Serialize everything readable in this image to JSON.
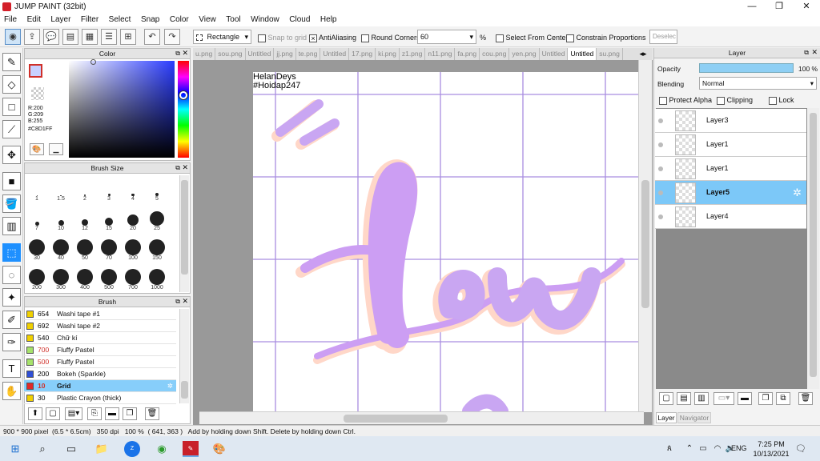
{
  "window": {
    "title": "JUMP PAINT (32bit)",
    "minimize": "—",
    "maximize": "❐",
    "close": "✕"
  },
  "menu": [
    "File",
    "Edit",
    "Layer",
    "Filter",
    "Select",
    "Snap",
    "Color",
    "View",
    "Tool",
    "Window",
    "Cloud",
    "Help"
  ],
  "toolbar": {
    "shape_select": "Rectangle",
    "snap_to_grid": "Snap to grid",
    "antialiasing": "AntiAliasing",
    "round_corners": "Round Corners",
    "round_value": "60",
    "percent": "%",
    "select_from_center": "Select From Center",
    "constrain_proportions": "Constrain Proportions",
    "deselect": "Deselec"
  },
  "color_panel": {
    "title": "Color",
    "r": "R:200",
    "g": "G:209",
    "b": "B:255",
    "hex": "#C8D1FF",
    "current_color": "#c8d1ff"
  },
  "brush_size_panel": {
    "title": "Brush Size",
    "sizes": [
      "1",
      "1.5",
      "2",
      "3",
      "4",
      "5",
      "7",
      "10",
      "12",
      "15",
      "20",
      "25",
      "30",
      "40",
      "50",
      "70",
      "100",
      "150",
      "200",
      "300",
      "400",
      "500",
      "700",
      "1000"
    ]
  },
  "brush_panel": {
    "title": "Brush",
    "items": [
      {
        "num": "654",
        "name": "Washi tape #1",
        "color": "#f0d000",
        "numColor": "#000"
      },
      {
        "num": "692",
        "name": "Washi tape #2",
        "color": "#f0d000",
        "numColor": "#000"
      },
      {
        "num": "540",
        "name": "Chữ kí",
        "color": "#f0d000",
        "numColor": "#000"
      },
      {
        "num": "700",
        "name": "Fluffy Pastel",
        "color": "#a6e26b",
        "numColor": "#d0302a"
      },
      {
        "num": "500",
        "name": "Fluffy Pastel",
        "color": "#a6e26b",
        "numColor": "#d0302a"
      },
      {
        "num": "200",
        "name": "Bokeh (Sparkle)",
        "color": "#2f4fd6",
        "numColor": "#000"
      },
      {
        "num": "10",
        "name": "Grid",
        "color": "#e02828",
        "numColor": "#d0302a"
      },
      {
        "num": "30",
        "name": "Plastic Crayon (thick)",
        "color": "#f0d000",
        "numColor": "#000"
      }
    ]
  },
  "tabs": [
    "u.png",
    "sou.png",
    "Untitled",
    "jj.png",
    "te.png",
    "Untitled",
    "17.png",
    "ki.png",
    "z1.png",
    "n11.png",
    "fa.png",
    "cou.png",
    "yen.png",
    "Untitled",
    "Untitled",
    "su.png"
  ],
  "canvas": {
    "watermark_line1": "HelanDeys",
    "watermark_line2": "#Hoidap247",
    "lettering": "Lew"
  },
  "layer_panel": {
    "title": "Layer",
    "opacity_label": "Opacity",
    "opacity_value": "100 %",
    "opacity_fraction": 1.0,
    "blending_label": "Blending",
    "blending_value": "Normal",
    "protect_alpha": "Protect Alpha",
    "clipping": "Clipping",
    "lock": "Lock",
    "layers": [
      "Layer3",
      "Layer1",
      "Layer1",
      "Layer5",
      "Layer4"
    ],
    "selected_index": 3,
    "tab_layer": "Layer",
    "tab_navigator": "Navigator"
  },
  "status": {
    "size": "900 * 900 pixel",
    "physical": "(6.5 * 6.5cm)",
    "dpi": "350 dpi",
    "zoom": "100 %",
    "coords": "( 641, 363 )",
    "hint": "Add by holding down Shift. Delete by holding down Ctrl."
  },
  "taskbar": {
    "lang": "ENG",
    "time": "7:25 PM",
    "date": "10/13/2021"
  }
}
